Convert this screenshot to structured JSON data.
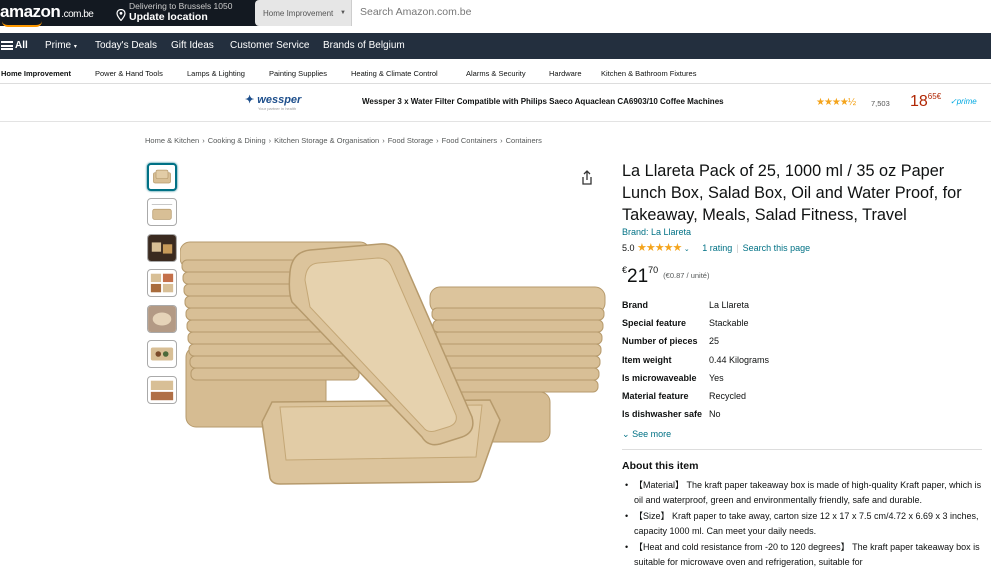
{
  "header": {
    "logo": "amazon",
    "logo_tld": ".com.be",
    "deliver_line1": "Delivering to Brussels 1050",
    "deliver_line2": "Update location",
    "search_category": "Home Improvement",
    "search_placeholder": "Search Amazon.com.be"
  },
  "nav": {
    "all": "All",
    "items": [
      "Prime",
      "Today's Deals",
      "Gift Ideas",
      "Customer Service",
      "Brands of Belgium"
    ]
  },
  "categories": [
    "Home Improvement",
    "Power & Hand Tools",
    "Lamps & Lighting",
    "Painting Supplies",
    "Heating & Climate Control",
    "Alarms & Security",
    "Hardware",
    "Kitchen & Bathroom Fixtures"
  ],
  "ad": {
    "brand": "wessper",
    "brand_sub": "Your partner in health",
    "title": "Wessper 3 x Water Filter Compatible with Philips Saeco Aquaclean CA6903/10 Coffee Machines",
    "stars": "★★★★½",
    "rating_count": "7,503",
    "price_whole": "18",
    "price_frac": "65",
    "price_cur": "€",
    "prime": "prime"
  },
  "breadcrumbs": [
    "Home & Kitchen",
    "Cooking & Dining",
    "Kitchen Storage & Organisation",
    "Food Storage",
    "Food Containers",
    "Containers"
  ],
  "breadcrumb_sep": "›",
  "product": {
    "title": "La Llareta Pack of 25, 1000 ml / 35 oz Paper Lunch Box, Salad Box, Oil and Water Proof, for Takeaway, Meals, Salad Fitness, Travel",
    "brand": "Brand: La Llareta",
    "rating_value": "5.0",
    "stars": "★★★★★",
    "rating_count": "1 rating",
    "search_page": "Search this page",
    "price_cur": "€",
    "price_whole": "21",
    "price_frac": "70",
    "unit_price": "(€0.87 / unité)"
  },
  "specs": [
    {
      "key": "Brand",
      "value": "La Llareta"
    },
    {
      "key": "Special feature",
      "value": "Stackable"
    },
    {
      "key": "Number of pieces",
      "value": "25"
    },
    {
      "key": "Item weight",
      "value": "0.44 Kilograms"
    },
    {
      "key": "Is microwaveable",
      "value": "Yes"
    },
    {
      "key": "Material feature",
      "value": "Recycled"
    },
    {
      "key": "Is dishwasher safe",
      "value": "No"
    }
  ],
  "see_more": "See more",
  "about": {
    "heading": "About this item",
    "bullets": [
      "【Material】 The kraft paper takeaway box is made of high-quality Kraft paper, which is oil and waterproof, green and environmentally friendly, safe and durable.",
      "【Size】 Kraft paper to take away, carton size 12 x 17 x 7.5 cm/4.72 x 6.69 x 3 inches, capacity 1000 ml. Can meet your daily needs.",
      "【Heat and cold resistance from -20 to 120 degrees】 The kraft paper takeaway box is suitable for microwave oven and refrigeration, suitable for"
    ]
  },
  "colors": {
    "header_bg": "#131921",
    "nav_bg": "#232f3e",
    "link": "#007185",
    "price_red": "#b12704",
    "star": "#f4a41c",
    "kraft": "#d8bf96"
  }
}
